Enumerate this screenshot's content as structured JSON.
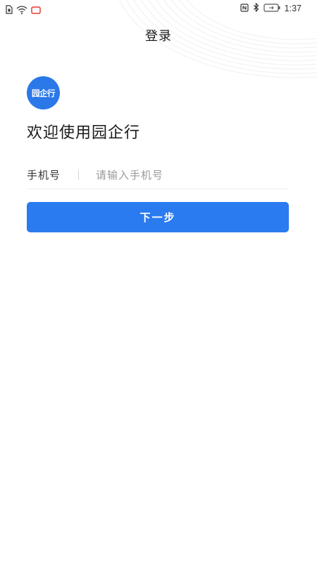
{
  "status_bar": {
    "time": "1:37",
    "icons_left": [
      "sim-icon",
      "wifi-icon",
      "notification-icon"
    ],
    "icons_right": [
      "nfc-icon",
      "bluetooth-icon",
      "battery-icon"
    ]
  },
  "header": {
    "title": "登录"
  },
  "logo": {
    "text": "园企行",
    "color": "#2b78e8"
  },
  "welcome": {
    "text": "欢迎使用园企行"
  },
  "phone": {
    "label": "手机号",
    "placeholder": "请输入手机号",
    "value": ""
  },
  "next_button": {
    "label": "下一步",
    "color": "#2b7bf0"
  }
}
